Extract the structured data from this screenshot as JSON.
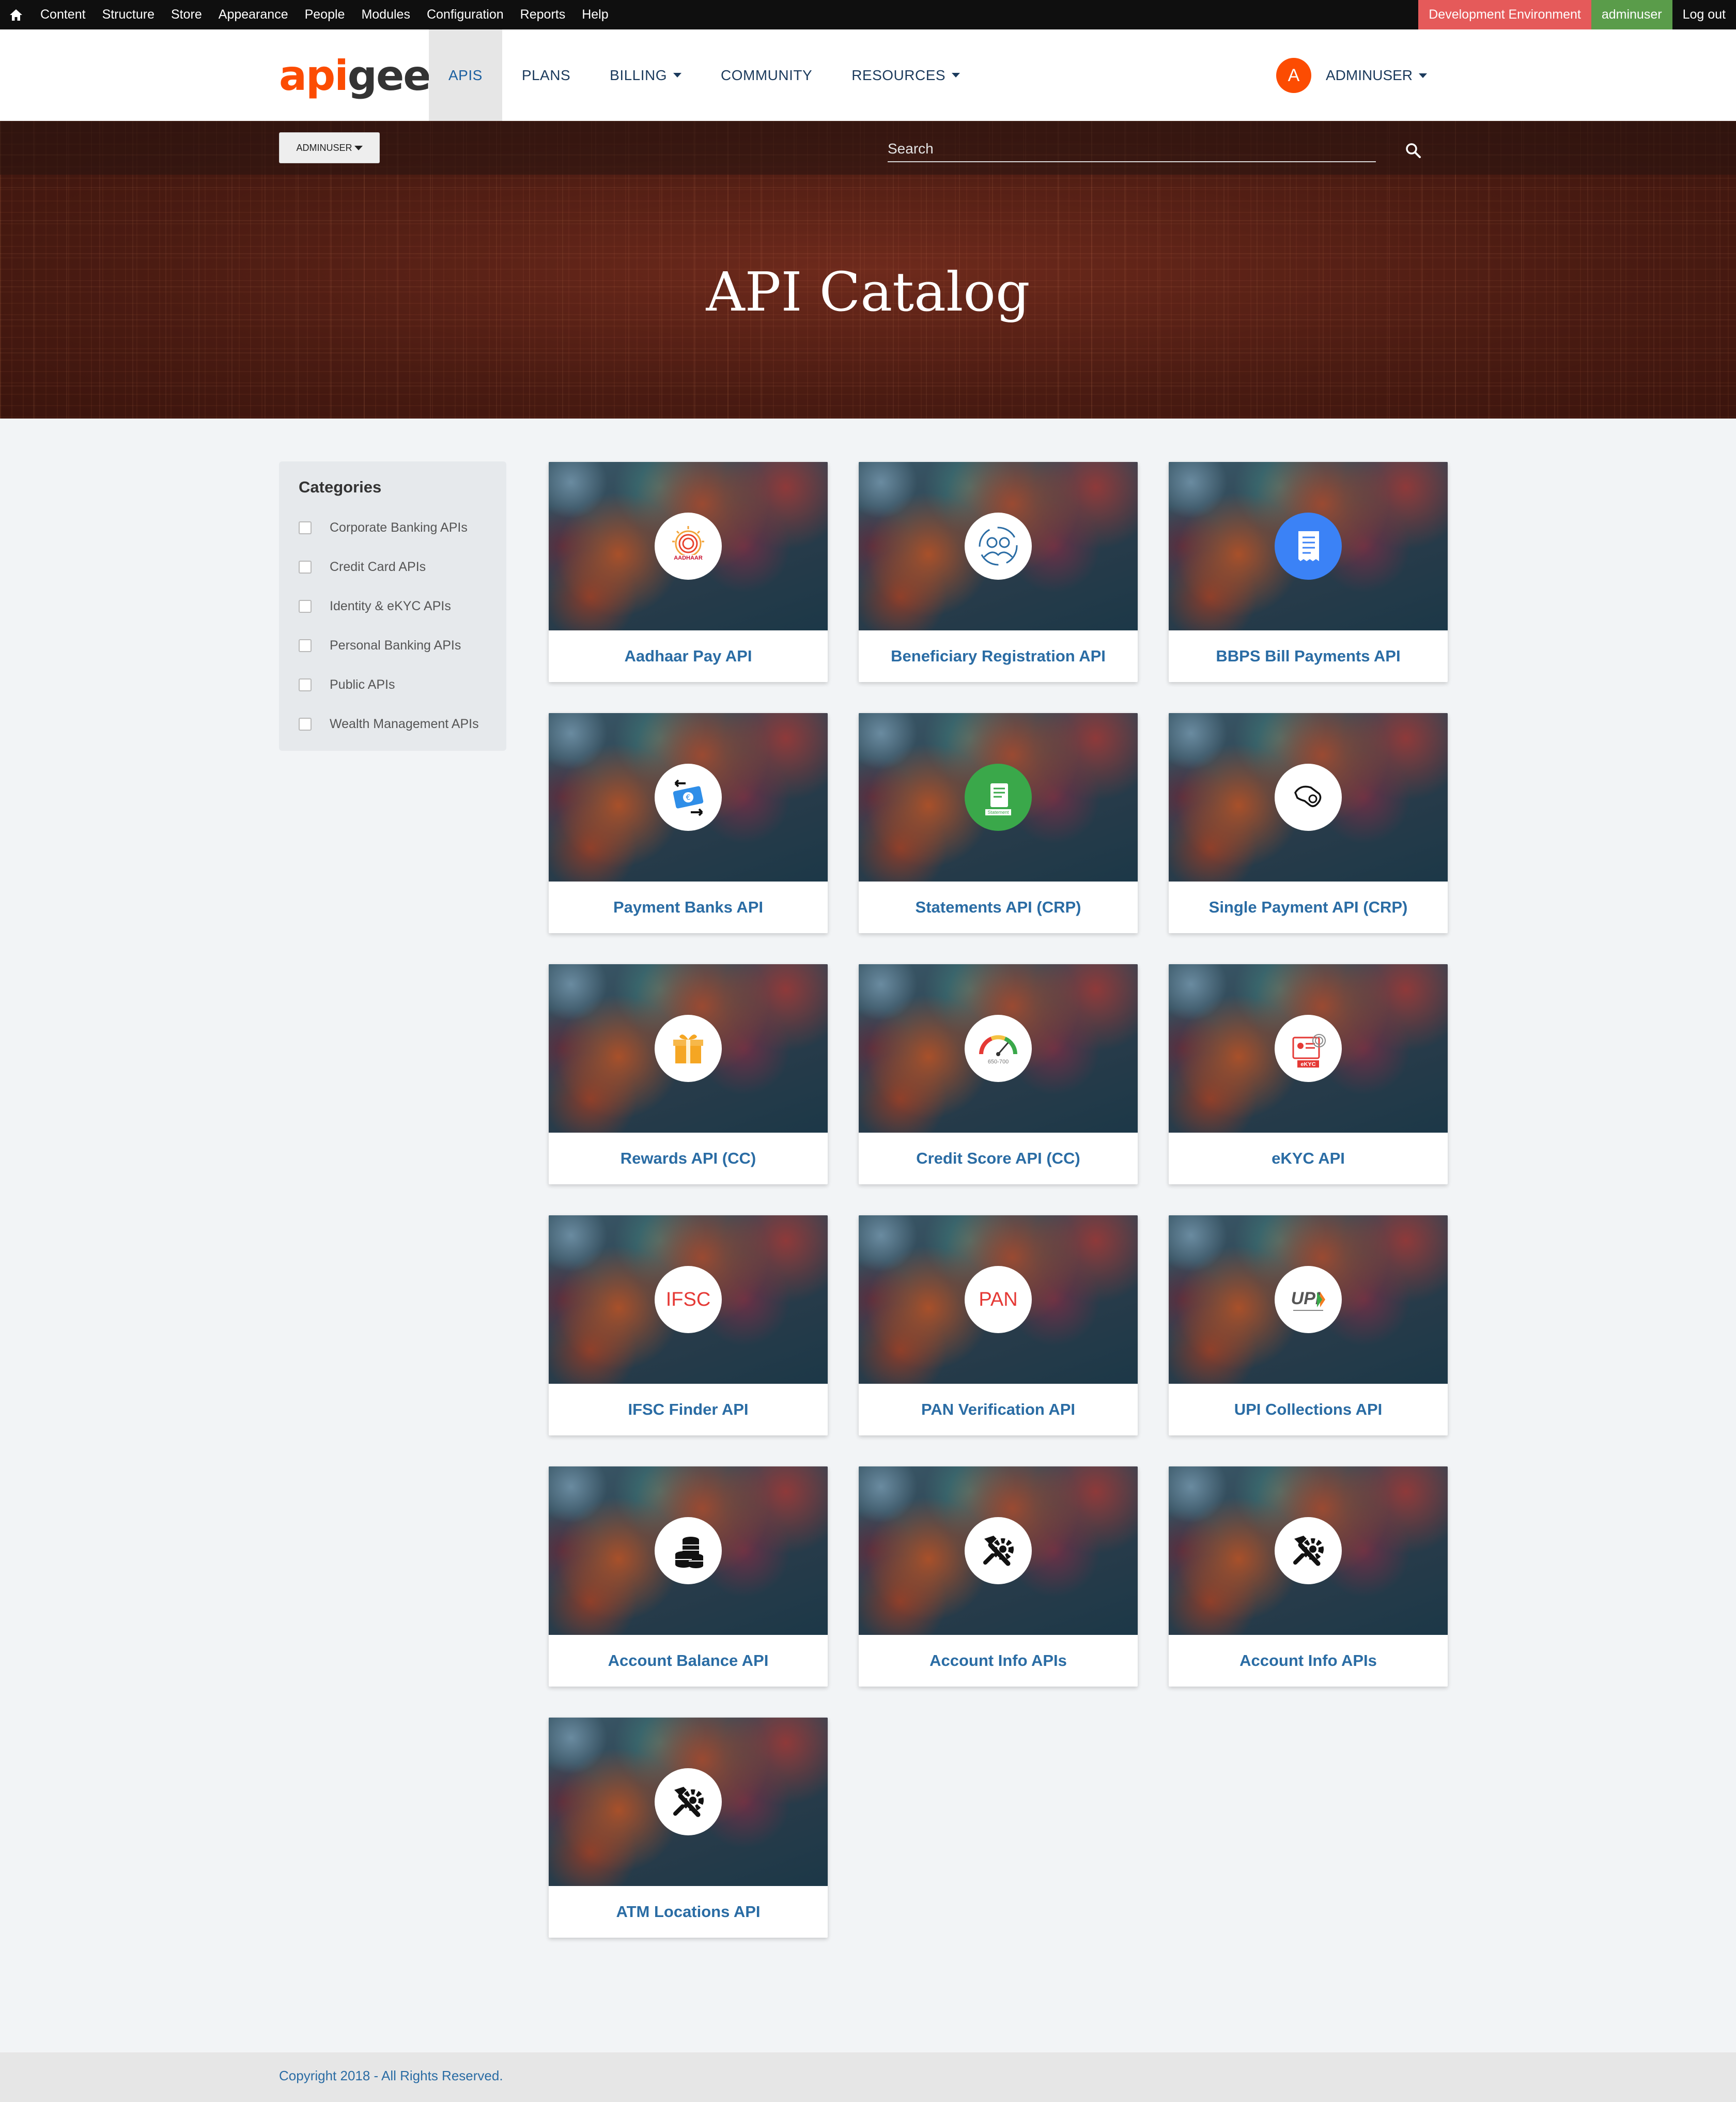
{
  "admin_bar": {
    "menu": [
      "Content",
      "Structure",
      "Store",
      "Appearance",
      "People",
      "Modules",
      "Configuration",
      "Reports",
      "Help"
    ],
    "environment": "Development Environment",
    "user": "adminuser",
    "logout": "Log out"
  },
  "header": {
    "logo_part1": "api",
    "logo_part2": "gee",
    "nav": [
      {
        "label": "APIS",
        "has_caret": false,
        "active": true
      },
      {
        "label": "PLANS",
        "has_caret": false,
        "active": false
      },
      {
        "label": "BILLING",
        "has_caret": true,
        "active": false
      },
      {
        "label": "COMMUNITY",
        "has_caret": false,
        "active": false
      },
      {
        "label": "RESOURCES",
        "has_caret": true,
        "active": false
      }
    ],
    "avatar_letter": "A",
    "user_menu": "ADMINUSER"
  },
  "hero": {
    "role_button": "ADMINUSER",
    "search_placeholder": "Search",
    "title": "API Catalog"
  },
  "categories": {
    "title": "Categories",
    "items": [
      "Corporate Banking APIs",
      "Credit Card APIs",
      "Identity & eKYC APIs",
      "Personal Banking APIs",
      "Public APIs",
      "Wealth Management APIs"
    ]
  },
  "cards": [
    {
      "title": "Aadhaar Pay API",
      "icon": "aadhaar-logo-icon"
    },
    {
      "title": "Beneficiary Registration API",
      "icon": "beneficiary-icon"
    },
    {
      "title": "BBPS Bill Payments API",
      "icon": "bill-receipt-icon"
    },
    {
      "title": "Payment Banks API",
      "icon": "money-transfer-icon"
    },
    {
      "title": "Statements API (CRP)",
      "icon": "statement-icon"
    },
    {
      "title": "Single Payment API (CRP)",
      "icon": "hand-payment-icon"
    },
    {
      "title": "Rewards API (CC)",
      "icon": "gift-box-icon"
    },
    {
      "title": "Credit Score API (CC)",
      "icon": "credit-gauge-icon"
    },
    {
      "title": "eKYC API",
      "icon": "ekyc-card-icon"
    },
    {
      "title": "IFSC Finder API",
      "icon": "ifsc-text-icon",
      "icon_text": "IFSC"
    },
    {
      "title": "PAN Verification API",
      "icon": "pan-text-icon",
      "icon_text": "PAN"
    },
    {
      "title": "UPI Collections API",
      "icon": "upi-logo-icon"
    },
    {
      "title": "Account Balance API",
      "icon": "coins-stack-icon"
    },
    {
      "title": "Account Info APIs",
      "icon": "tools-gear-icon"
    },
    {
      "title": "Account Info APIs",
      "icon": "tools-gear-icon"
    },
    {
      "title": "ATM Locations API",
      "icon": "tools-gear-icon"
    }
  ],
  "icon_texts": {
    "aadhaar": "AADHAAR",
    "statement": "Statement",
    "ekyc": "eKYC",
    "score": "650-700",
    "upi": "UPI"
  },
  "footer": {
    "copyright": "Copyright 2018 - All Rights Reserved."
  },
  "colors": {
    "brand": "#fc4c02",
    "link": "#2a6ca4",
    "env_badge": "#e55a5a",
    "user_badge": "#5a9c4a"
  }
}
